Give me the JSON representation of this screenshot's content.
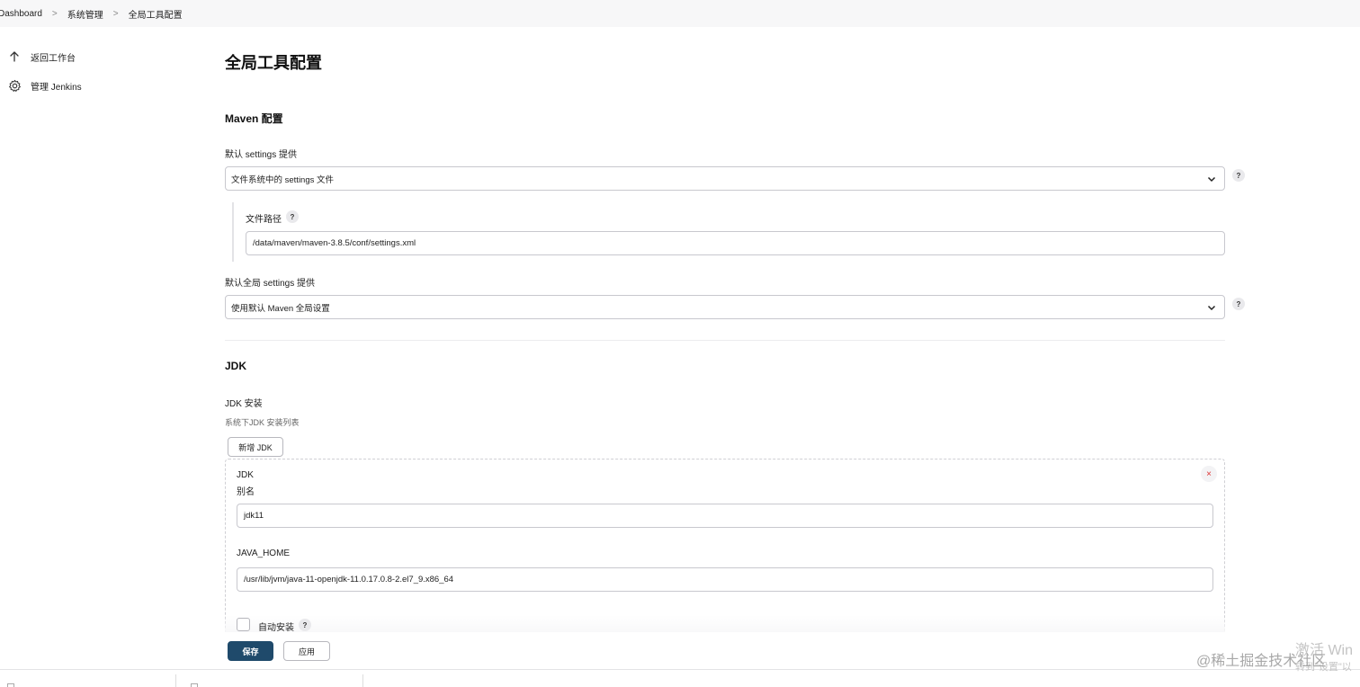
{
  "breadcrumb": [
    "Dashboard",
    "系统管理",
    "全局工具配置"
  ],
  "sidebar": {
    "items": [
      {
        "label": "返回工作台",
        "icon": "arrow-up-icon"
      },
      {
        "label": "管理 Jenkins",
        "icon": "gear-icon"
      }
    ]
  },
  "page": {
    "title": "全局工具配置"
  },
  "maven": {
    "section_title": "Maven 配置",
    "default_settings_label": "默认 settings 提供",
    "default_settings_value": "文件系统中的 settings 文件",
    "file_path_label": "文件路径",
    "file_path_value": "/data/maven/maven-3.8.5/conf/settings.xml",
    "global_settings_label": "默认全局 settings 提供",
    "global_settings_value": "使用默认 Maven 全局设置"
  },
  "jdk": {
    "section_title": "JDK",
    "install_label": "JDK 安装",
    "install_desc": "系统下JDK 安装列表",
    "add_button": "新增 JDK",
    "item_header": "JDK",
    "alias_label": "别名",
    "alias_value": "jdk11",
    "java_home_label": "JAVA_HOME",
    "java_home_value": "/usr/lib/jvm/java-11-openjdk-11.0.17.0.8-2.el7_9.x86_64",
    "auto_install_label": "自动安装",
    "auto_install_checked": false
  },
  "actions": {
    "save": "保存",
    "apply": "应用"
  },
  "help_glyph": "?",
  "close_glyph": "×",
  "overlay": {
    "watermark": "@稀土掘金技术社区",
    "activate_title": "激活 Win",
    "activate_sub": "转到\"设置\"以"
  }
}
